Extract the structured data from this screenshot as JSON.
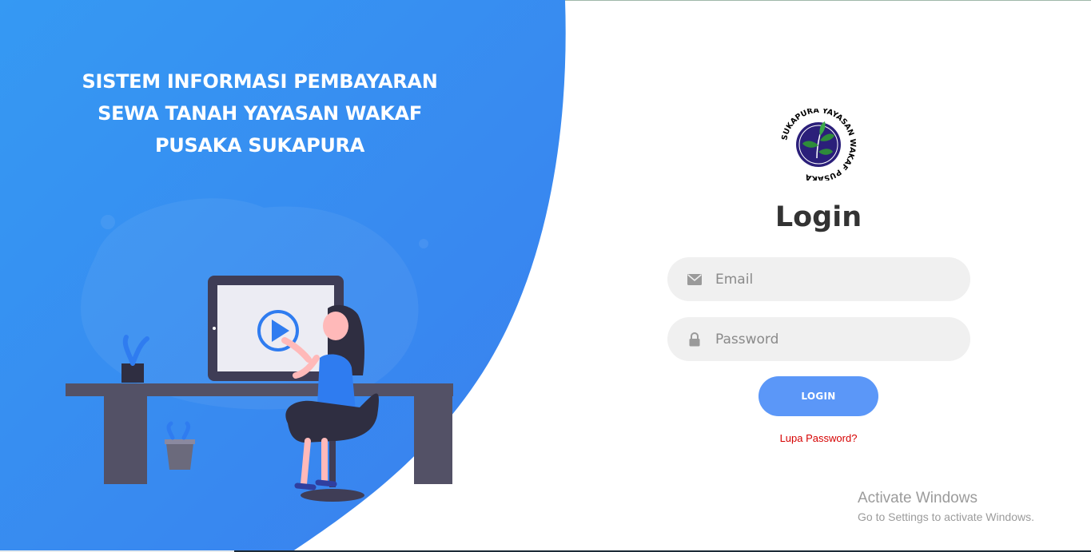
{
  "app": {
    "headline_line1": "SISTEM INFORMASI PEMBAYARAN",
    "headline_line2": "SEWA TANAH YAYASAN WAKAF",
    "headline_line3": "PUSAKA SUKAPURA"
  },
  "logo": {
    "text": "SUKAPURA YAYASAN WAKAF PUSAKA",
    "icon": "leaf-seal-icon"
  },
  "login": {
    "title": "Login",
    "email_placeholder": "Email",
    "email_value": "",
    "email_icon": "envelope-icon",
    "password_placeholder": "Password",
    "password_value": "",
    "password_icon": "lock-icon",
    "button_label": "LOGIN",
    "forgot_label": "Lupa Password?"
  },
  "windows_watermark": {
    "line1": "Activate Windows",
    "line2": "Go to Settings to activate Windows."
  },
  "colors": {
    "panel_blue": "#3a8af0",
    "button_blue": "#5b97f8",
    "link_red": "#d60000",
    "field_grey": "#f0f0f0"
  }
}
